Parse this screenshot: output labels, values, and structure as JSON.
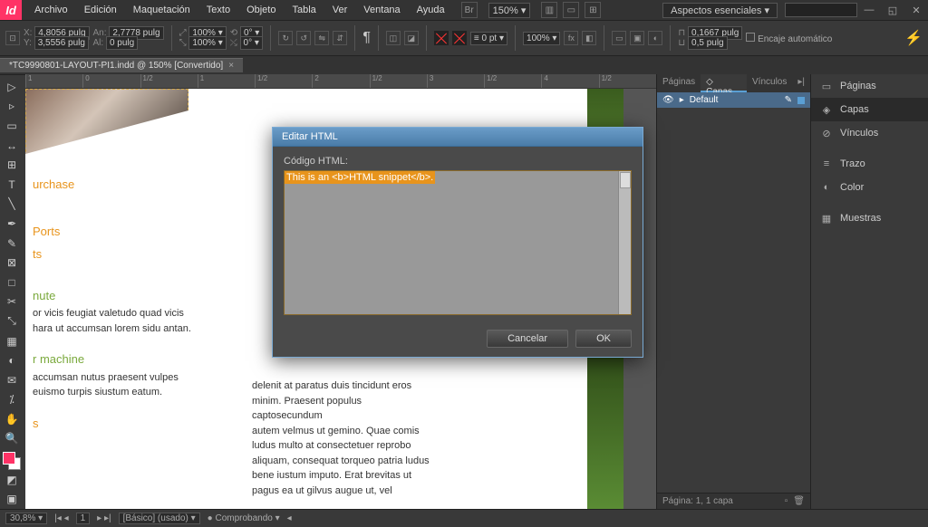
{
  "app": {
    "icon_text": "Id"
  },
  "menu": [
    "Archivo",
    "Edición",
    "Maquetación",
    "Texto",
    "Objeto",
    "Tabla",
    "Ver",
    "Ventana",
    "Ayuda"
  ],
  "top": {
    "zoom": "150%",
    "workspace": "Aspectos esenciales"
  },
  "ctrl": {
    "x": "4,8056 pulg",
    "y": "3,5556 pulg",
    "w": "2,7778 pulg",
    "h": "0 pulg",
    "sx": "100%",
    "sy": "100%",
    "rot": "0°",
    "shear": "0°",
    "stroke": "0 pt",
    "fx100": "100%",
    "dim": "0,1667 pulg",
    "gap": "0,5 pulg",
    "autofit": "Encaje automático"
  },
  "tab": "*TC9990801-LAYOUT-PI1.indd @ 150% [Convertido]",
  "ruler": [
    "1",
    "0",
    "1/2",
    "1",
    "1/2",
    "2",
    "1/2",
    "3",
    "1/2",
    "4",
    "1/2"
  ],
  "doc": {
    "h1": "urchase",
    "h2": "Ports",
    "h2b": "ts",
    "h3": "nute",
    "p3a": "or vicis feugiat valetudo quad vicis",
    "p3b": "hara ut accumsan lorem sidu antan.",
    "h4": "r machine",
    "p4a": "accumsan nutus praesent vulpes",
    "p4b": "euismo turpis siustum eatum.",
    "h5": "s",
    "c2a": "delenit at paratus duis tincidunt eros",
    "c2b": "minim. Praesent populus captosecundum",
    "c2c": "autem velmus ut gemino. Quae comis",
    "c2d": "ludus multo at consectetuer reprobo",
    "c2e": "aliquam, consequat torqueo patria ludus",
    "c2f": "bene iustum imputo. Erat brevitas ut",
    "c2g": "pagus ea ut gilvus augue ut, vel"
  },
  "mid_panel": {
    "tabs": [
      "Páginas",
      "Capas",
      "Vínculos"
    ],
    "active_tab": 1,
    "layer": "Default",
    "footer": "Página: 1, 1 capa"
  },
  "right_panel": {
    "items": [
      {
        "icon": "▭",
        "label": "Páginas"
      },
      {
        "icon": "◈",
        "label": "Capas"
      },
      {
        "icon": "⊘",
        "label": "Vínculos"
      },
      {
        "sep": true
      },
      {
        "icon": "≡",
        "label": "Trazo"
      },
      {
        "icon": "◐",
        "label": "Color"
      },
      {
        "sep": true
      },
      {
        "icon": "▦",
        "label": "Muestras"
      }
    ],
    "active": 1
  },
  "dialog": {
    "title": "Editar HTML",
    "label": "Código HTML:",
    "content": "This is an <b>HTML snippet</b>.",
    "cancel": "Cancelar",
    "ok": "OK"
  },
  "status": {
    "zoom": "30,8%",
    "page_nav": "1",
    "style": "[Básico] (usado)",
    "task": "Comprobando"
  }
}
